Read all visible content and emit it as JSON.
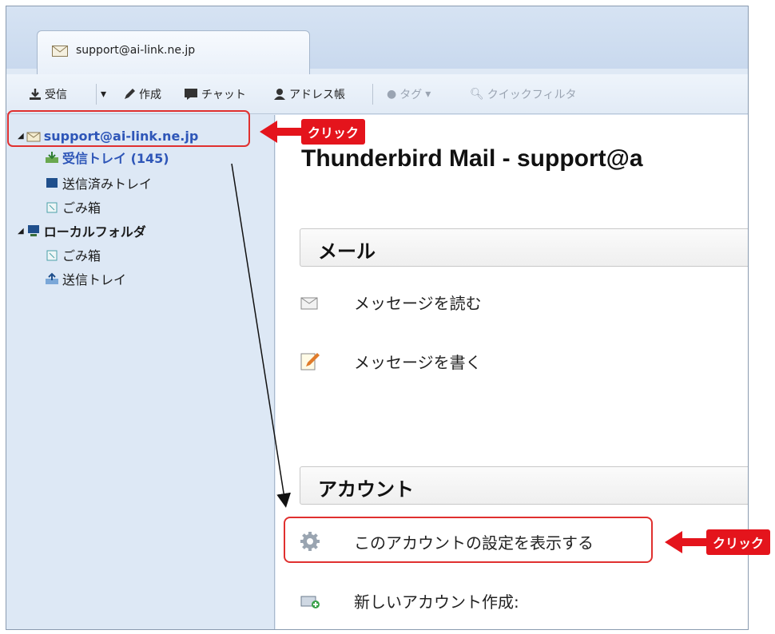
{
  "tab": {
    "label": "support@ai-link.ne.jp",
    "icon": "mail-account-icon"
  },
  "toolbar": {
    "get_mail": "受信",
    "compose": "作成",
    "chat": "チャット",
    "address_book": "アドレス帳",
    "tag": "タグ",
    "quick_filter": "クイックフィルタ"
  },
  "sidebar": {
    "account": "support@ai-link.ne.jp",
    "inbox": "受信トレイ (145)",
    "sent": "送信済みトレイ",
    "trash": "ごみ箱",
    "local_folders": "ローカルフォルダ",
    "local_trash": "ごみ箱",
    "outbox": "送信トレイ"
  },
  "content": {
    "title": "Thunderbird Mail - support@a",
    "mail_section": "メール",
    "read_messages": "メッセージを読む",
    "write_message": "メッセージを書く",
    "account_section": "アカウント",
    "view_settings": "このアカウントの設定を表示する",
    "new_account": "新しいアカウント作成:"
  },
  "annotations": {
    "click_label_1": "クリック",
    "click_label_2": "クリック",
    "highlight_color": "#e0302f",
    "callout_color": "#e4141c"
  }
}
